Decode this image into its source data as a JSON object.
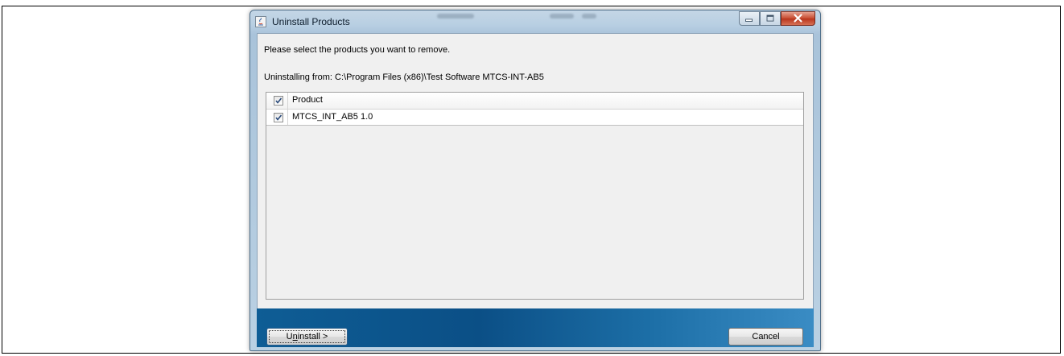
{
  "window": {
    "title": "Uninstall Products"
  },
  "dialog": {
    "prompt": "Please select the products you want to remove.",
    "from_label": "Uninstalling from: C:\\Program Files (x86)\\Test Software MTCS-INT-AB5"
  },
  "table": {
    "header": {
      "label": "Product",
      "checked": true
    },
    "rows": [
      {
        "label": "MTCS_INT_AB5 1.0",
        "checked": true
      }
    ]
  },
  "buttons": {
    "uninstall": {
      "prefix": "U",
      "mnemonic": "n",
      "rest": "install >"
    },
    "cancel": "Cancel"
  },
  "icons": {
    "app": "java-icon",
    "minimize": "minimize-icon",
    "maximize": "maximize-icon",
    "close": "close-icon",
    "checkbox": "checkmark-icon"
  }
}
